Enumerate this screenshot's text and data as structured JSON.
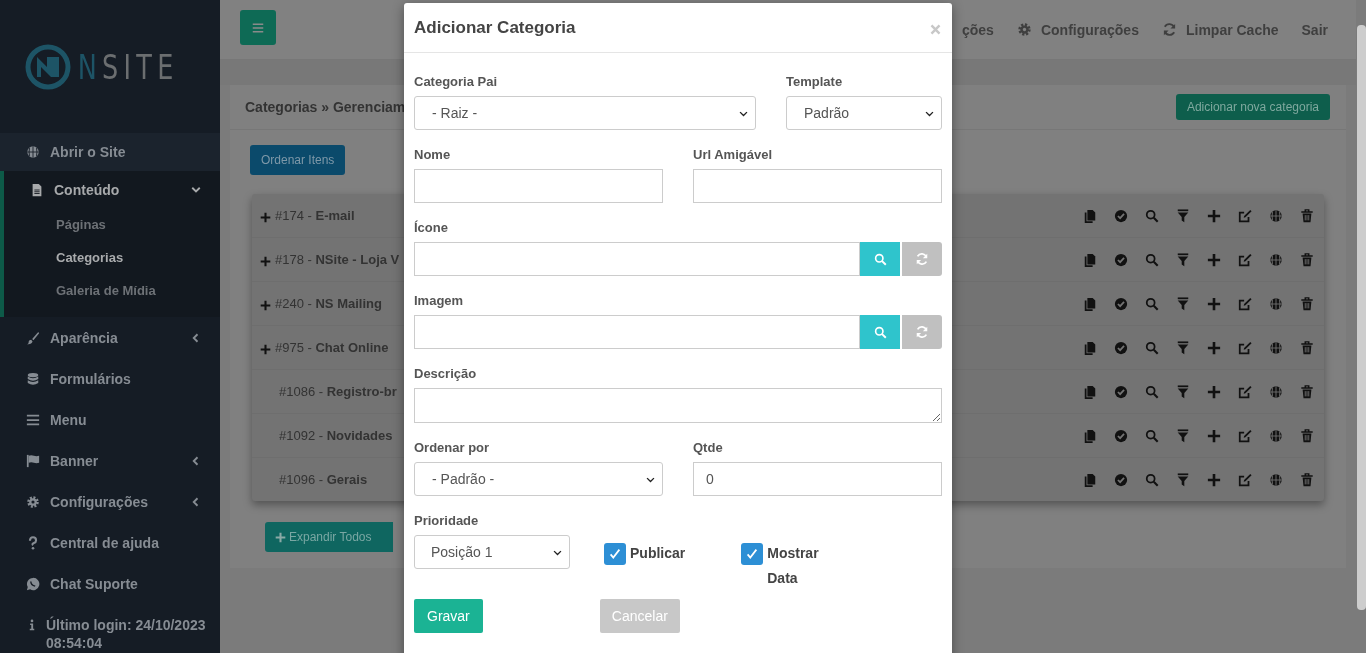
{
  "sidebar": {
    "logo": "NSITE",
    "items": [
      {
        "label": "Abrir o Site",
        "selected": false,
        "hovered": true
      },
      {
        "label": "Conteúdo",
        "selected": true,
        "hovered": false,
        "expanded": true,
        "children": [
          {
            "label": "Páginas",
            "selected": false
          },
          {
            "label": "Categorias",
            "selected": true
          },
          {
            "label": "Galeria de Mídia",
            "selected": false
          }
        ]
      },
      {
        "label": "Aparência",
        "selected": false,
        "hovered": false,
        "expanded": false
      },
      {
        "label": "Formulários",
        "selected": false,
        "hovered": false
      },
      {
        "label": "Menu",
        "selected": false,
        "hovered": false
      },
      {
        "label": "Banner",
        "selected": false,
        "hovered": false,
        "expanded": false
      },
      {
        "label": "Configurações",
        "selected": false,
        "hovered": false,
        "expanded": false
      },
      {
        "label": "Central de ajuda",
        "selected": false,
        "hovered": false
      },
      {
        "label": "Chat Suporte",
        "selected": false,
        "hovered": false
      }
    ],
    "last_login": "Último login: 24/10/2023 08:54:04"
  },
  "topbar": {
    "nav": [
      "ções",
      "Configurações",
      "Limpar Cache",
      "Sair"
    ]
  },
  "panel": {
    "breadcrumb": "Categorias » Gerenciam",
    "add_button": "Adicionar nova categoria",
    "order_button": "Ordenar Itens",
    "rows": [
      {
        "label": "#174 - **E-mail**",
        "expandable": true
      },
      {
        "label": "#178 - **NSite - Loja V**",
        "expandable": true
      },
      {
        "label": "#240 - **NS Mailing**",
        "expandable": true
      },
      {
        "label": "#975 - **Chat Online**",
        "expandable": true
      },
      {
        "label": "#1086 - **Registro-br**",
        "expandable": false
      },
      {
        "label": "#1092 - **Novidades**",
        "expandable": false
      },
      {
        "label": "#1096 - **Gerais**",
        "expandable": false
      }
    ],
    "expand_button": "Expandir Todos"
  },
  "modal": {
    "title": "Adicionar Categoria",
    "parent": {
      "label": "Categoria Pai",
      "value": "- Raiz -"
    },
    "template": {
      "label": "Template",
      "value": "Padrão"
    },
    "name": {
      "label": "Nome"
    },
    "slug": {
      "label": "Url Amigável"
    },
    "icon": {
      "label": "Ícone"
    },
    "image": {
      "label": "Imagem"
    },
    "description": {
      "label": "Descrição"
    },
    "order_by": {
      "label": "Ordenar por",
      "value": "- Padrão -"
    },
    "quantity": {
      "label": "Qtde",
      "value": "0"
    },
    "priority": {
      "label": "Prioridade",
      "value": "Posição 1"
    },
    "checkboxes": [
      {
        "label": "Publicar",
        "checked": true
      },
      {
        "label": "Mostrar Data",
        "checked": true
      }
    ],
    "save_button": "Gravar",
    "cancel_button": "Cancelar"
  }
}
